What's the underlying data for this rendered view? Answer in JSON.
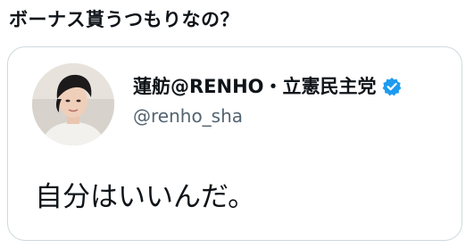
{
  "caption": "ボーナス貰うつもりなの？",
  "quoted_tweet": {
    "display_name": "蓮舫@RENHO・立憲民主党",
    "handle": "@renho_sha",
    "text": "自分はいいんだ。",
    "verified": true,
    "verified_badge_color": "#1d9bf0"
  }
}
